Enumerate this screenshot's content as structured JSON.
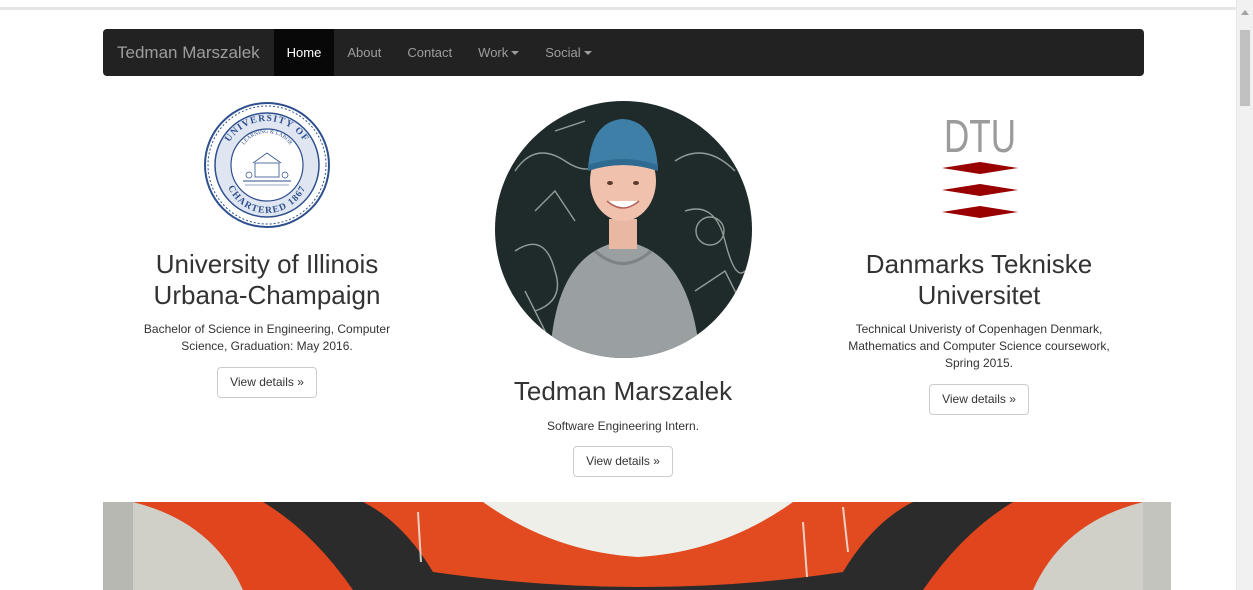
{
  "navbar": {
    "brand": "Tedman Marszalek",
    "items": [
      {
        "label": "Home",
        "active": true
      },
      {
        "label": "About"
      },
      {
        "label": "Contact"
      },
      {
        "label": "Work",
        "dropdown": true
      },
      {
        "label": "Social",
        "dropdown": true
      }
    ]
  },
  "columns": {
    "left": {
      "title_line1": "University of Illinois",
      "title_line2": "Urbana-Champaign",
      "desc_line1": "Bachelor of Science in Engineering, Computer",
      "desc_line2": "Science, Graduation: May 2016.",
      "button": "View details »",
      "seal": {
        "top": "UNIVERSITY OF",
        "right": "ILLINOIS",
        "bottom": "CHARTERED 1867",
        "left": "UNIVERSITY",
        "motto": "LEARNING & LABOR"
      }
    },
    "center": {
      "title": "Tedman Marszalek",
      "desc": "Software Engineering Intern.",
      "button": "View details »"
    },
    "right": {
      "logo_text": "DTU",
      "title_line1": "Danmarks Tekniske",
      "title_line2": "Universitet",
      "desc_line1": "Technical Univeristy of Copenhagen Denmark,",
      "desc_line2": "Mathematics and Computer Science coursework,",
      "desc_line3": "Spring 2015.",
      "button": "View details »"
    }
  },
  "colors": {
    "navbar_bg": "#222222",
    "active_bg": "#080808",
    "dtu_red": "#990000",
    "dtu_gray": "#9b9b9b",
    "seal_blue": "#2e4f8e"
  }
}
